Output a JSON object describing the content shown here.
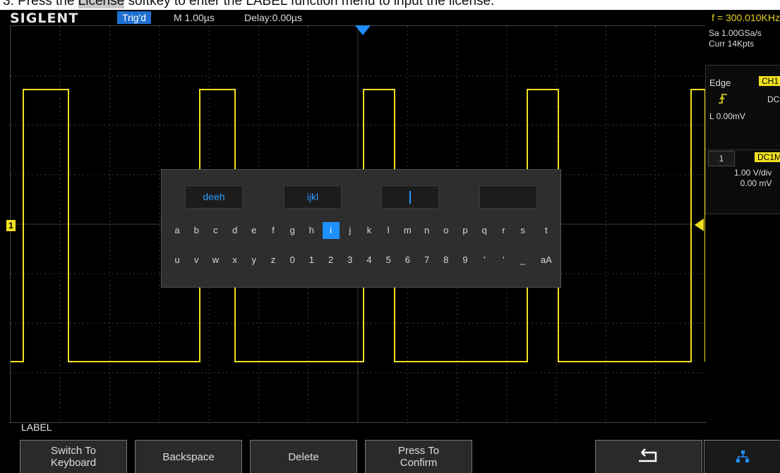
{
  "doc": {
    "instruction_pre": "3.  Press the ",
    "instruction_key": "License",
    "instruction_post": " softkey to enter the LABEL function menu to input the license."
  },
  "topbar": {
    "brand": "SIGLENT",
    "trig_status": "Trig'd",
    "timebase": "M 1.00µs",
    "delay": "Delay:0.00µs",
    "frequency": "f = 300.010KHz"
  },
  "right_panel": {
    "sample_rate": "Sa 1.00GSa/s",
    "memory_depth": "Curr 14Kpts",
    "trigger_type": "Edge",
    "trigger_source": "CH1",
    "trigger_slope_icon": "rising-edge-icon",
    "trigger_coupling": "DC",
    "trigger_level": "L  0.00mV",
    "channel_tab": "1",
    "channel_coupling": "DC1M",
    "channel_scale": "1.00 V/div",
    "channel_offset": "0.00 mV"
  },
  "markers": {
    "channel_marker": "1",
    "waveform_color": "#f0e020",
    "trigger_marker_color": "#1e8fff"
  },
  "keyboard": {
    "fields": [
      "deeh",
      "ijkl",
      "",
      ""
    ],
    "row1": [
      "a",
      "b",
      "c",
      "d",
      "e",
      "f",
      "g",
      "h",
      "i",
      "j",
      "k",
      "l",
      "m",
      "n",
      "o",
      "p",
      "q",
      "r",
      "s",
      "t"
    ],
    "row2": [
      "u",
      "v",
      "w",
      "x",
      "y",
      "z",
      "0",
      "1",
      "2",
      "3",
      "4",
      "5",
      "6",
      "7",
      "8",
      "9",
      "'",
      "'",
      "_",
      "aA"
    ],
    "selected_key": "i"
  },
  "softkeys": {
    "menu_title": "LABEL",
    "switch_line1": "Switch To",
    "switch_line2": "Keyboard",
    "backspace": "Backspace",
    "delete": "Delete",
    "confirm_line1": "Press To",
    "confirm_line2": "Confirm",
    "return_icon": "return-arrow-icon",
    "network_icon": "network-icon"
  }
}
